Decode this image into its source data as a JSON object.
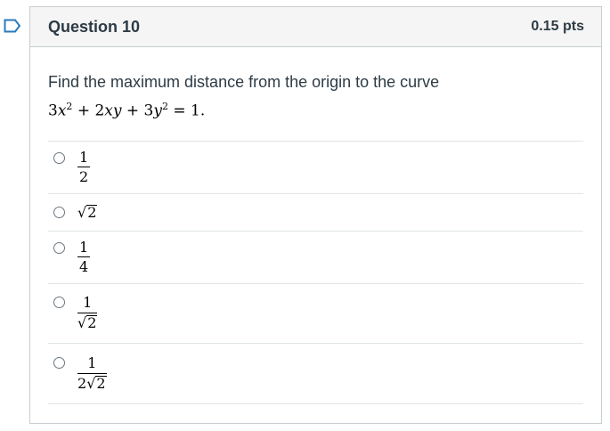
{
  "question": {
    "title": "Question 10",
    "points": "0.15 pts",
    "prompt": "Find the maximum distance from the origin to the curve"
  },
  "answers": [
    {
      "numerator": "1",
      "denominator": "2"
    },
    {
      "radicand": "2"
    },
    {
      "numerator": "1",
      "denominator": "4"
    },
    {
      "numerator": "1",
      "denominator_radicand": "2"
    },
    {
      "numerator": "1",
      "denominator_coef": "2",
      "denominator_radicand": "2"
    }
  ],
  "colors": {
    "flag": "#2b7abc",
    "header_bg": "#f5f5f5",
    "border": "#c7cdd1",
    "text": "#2d3b45"
  },
  "icons": {
    "flag": "bookmark-flag-icon",
    "radio": "radio-circle-icon",
    "sqrt": "radical-sign"
  }
}
